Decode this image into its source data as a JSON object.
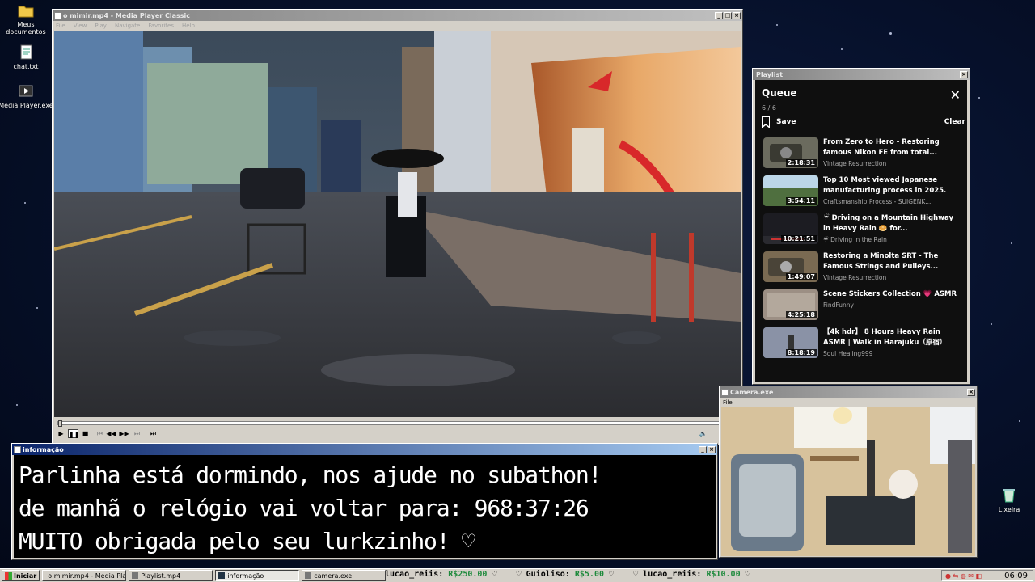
{
  "desktop": {
    "icons": [
      {
        "label": "Meus documentos",
        "icon": "folder-icon"
      },
      {
        "label": "chat.txt",
        "icon": "text-file-icon"
      },
      {
        "label": "Media Player.exe",
        "icon": "media-player-icon"
      },
      {
        "label": "Lixeira",
        "icon": "recycle-bin-icon"
      }
    ]
  },
  "media_player": {
    "title": "o mimir.mp4 - Media Player Classic",
    "menu": [
      "File",
      "View",
      "Play",
      "Navigate",
      "Favorites",
      "Help"
    ],
    "seek_progress": 0.0,
    "controls": [
      "play",
      "pause",
      "stop",
      "prev",
      "rewind",
      "forward",
      "next",
      "frame-step"
    ]
  },
  "info_window": {
    "title": "informação",
    "lines": [
      "Parlinha está dormindo, nos ajude no subathon!",
      "de manhã o relógio vai voltar para:  968:37:26",
      "MUITO obrigada pelo seu lurkzinho! ♡"
    ]
  },
  "playlist_window": {
    "title": "Playlist",
    "queue_title": "Queue",
    "count": "6 / 6",
    "save_label": "Save",
    "clear_label": "Clear",
    "items": [
      {
        "title": "From Zero to Hero - Restoring famous Nikon FE from total...",
        "channel": "Vintage Resurrection",
        "duration": "2:18:31",
        "thumb_color": "#6b6b5e"
      },
      {
        "title": "Top 10 Most viewed Japanese manufacturing process in 2025.",
        "channel": "Craftsmanship Process - SUIGENK...",
        "duration": "3:54:11",
        "thumb_color": "#5c7a4e"
      },
      {
        "title": "☔ Driving on a Mountain Highway in Heavy Rain 🥯 for...",
        "channel": "☔ Driving in the Rain",
        "duration": "10:21:51",
        "thumb_color": "#1c1c22"
      },
      {
        "title": "Restoring a Minolta SRT - The Famous Strings and Pulleys...",
        "channel": "Vintage Resurrection",
        "duration": "1:49:07",
        "thumb_color": "#7a6a52"
      },
      {
        "title": "Scene Stickers Collection 💗 ASMR",
        "channel": "FindFunny",
        "duration": "4:25:18",
        "thumb_color": "#9c8f84"
      },
      {
        "title": "【4k hdr】 8 Hours Heavy Rain ASMR | Walk in Harajuku（原宿）Tokyo Japan...",
        "channel": "Soul Healing999",
        "duration": "8:18:19",
        "thumb_color": "#6e7fa0"
      }
    ]
  },
  "camera_window": {
    "title": "Camera.exe",
    "menu": [
      "File"
    ]
  },
  "taskbar": {
    "start_label": "Iniciar",
    "buttons": [
      {
        "label": "o mimir.mp4 - Media Playe...",
        "active": false
      },
      {
        "label": "Playlist.mp4",
        "active": false
      },
      {
        "label": "informação",
        "active": true
      },
      {
        "label": "camera.exe",
        "active": false
      }
    ],
    "ticker": [
      {
        "user": "lucao_reiis:",
        "amount": "R$250.00"
      },
      {
        "user": "Guioliso:",
        "amount": "R$5.00"
      },
      {
        "user": "lucao_reiis:",
        "amount": "R$10.00"
      }
    ],
    "clock": "06:09"
  }
}
